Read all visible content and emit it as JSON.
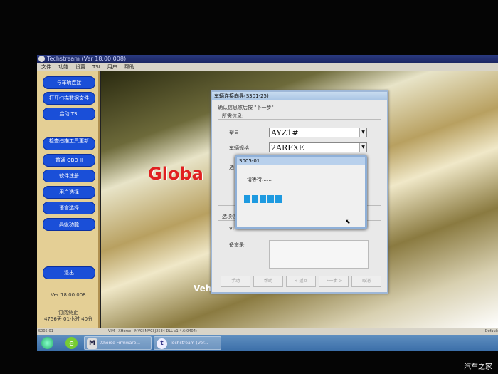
{
  "window": {
    "title": "Techstream (Ver 18.00.008)"
  },
  "menu": [
    "文件",
    "功能",
    "设置",
    "TSI",
    "用户",
    "帮助"
  ],
  "sidebar": {
    "buttons": [
      "与车辆连接",
      "打开扫描数据文件",
      "启动 TSI",
      "检查扫描工具更新",
      "普通 OBD II",
      "软件注册",
      "用户选择",
      "语言选择",
      "高级功能",
      "退出"
    ],
    "version": "Ver 18.00.008",
    "subscription_label": "订阅终止",
    "subscription_remaining": "4756天 01小时 40分"
  },
  "background": {
    "logo_text": "Globa",
    "bottom_text": "Vehi"
  },
  "dialog": {
    "title": "车辆连接向导(S301-25)",
    "instruction": "确认信息然后按 \"下一步\"",
    "group_required": "所需信息:",
    "model_label": "型号",
    "model_value": "AYZ1#",
    "spec_label": "车辆规格",
    "spec_value": "2ARFXE",
    "option_label_partial": "选",
    "group_optional_partial": "选项信",
    "vin_label_partial": "VI",
    "memo_label": "备忘录:",
    "buttons": [
      "手动",
      "帮助",
      "< 返回",
      "下一步 >",
      "取消"
    ]
  },
  "popup": {
    "title": "S005-01",
    "message": "请等待……",
    "progress_blocks": 5
  },
  "statusbar": {
    "left": "S005-01",
    "center": "VIM - XHorse - MVCI MVCI J2534 DLL v1.4.6(0404)",
    "right": "Default"
  },
  "taskbar": {
    "items": [
      "Xhorse Firmware...",
      "Techstream (Ver..."
    ]
  },
  "watermark": "汽车之家"
}
